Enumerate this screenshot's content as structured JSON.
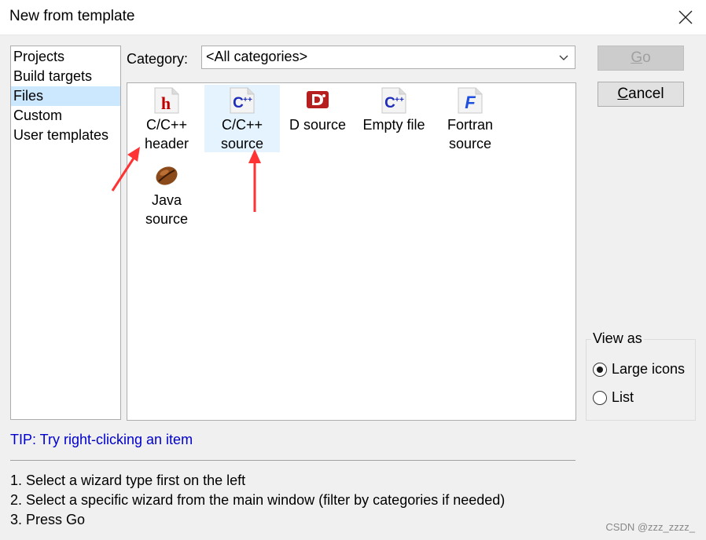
{
  "window": {
    "title": "New from template"
  },
  "sidebar": {
    "items": [
      {
        "label": "Projects",
        "selected": false
      },
      {
        "label": "Build targets",
        "selected": false
      },
      {
        "label": "Files",
        "selected": true
      },
      {
        "label": "Custom",
        "selected": false
      },
      {
        "label": "User templates",
        "selected": false
      }
    ]
  },
  "category": {
    "label": "Category:",
    "value": "<All categories>"
  },
  "templates": [
    {
      "line1": "C/C++",
      "line2": "header",
      "icon": "c-header-icon"
    },
    {
      "line1": "C/C++",
      "line2": "source",
      "icon": "cpp-source-icon",
      "highlighted": true
    },
    {
      "line1": "D source",
      "line2": "",
      "icon": "d-source-icon"
    },
    {
      "line1": "Empty file",
      "line2": "",
      "icon": "empty-file-icon"
    },
    {
      "line1": "Fortran",
      "line2": "source",
      "icon": "fortran-source-icon"
    },
    {
      "line1": "Java",
      "line2": "source",
      "icon": "java-source-icon"
    }
  ],
  "buttons": {
    "go": {
      "label": "Go",
      "enabled": false
    },
    "cancel": {
      "label": "Cancel"
    }
  },
  "view_as": {
    "legend": "View as",
    "options": [
      {
        "label": "Large icons",
        "checked": true
      },
      {
        "label": "List",
        "checked": false
      }
    ]
  },
  "tip": "TIP: Try right-clicking an item",
  "instructions": [
    "1. Select a wizard type first on the left",
    "2. Select a specific wizard from the main window (filter by categories if needed)",
    "3. Press Go"
  ],
  "watermark": "CSDN @zzz_zzzz_",
  "colors": {
    "selection": "#cce8ff",
    "tip": "#0000cd",
    "annotation_arrow": "#ff3333"
  }
}
